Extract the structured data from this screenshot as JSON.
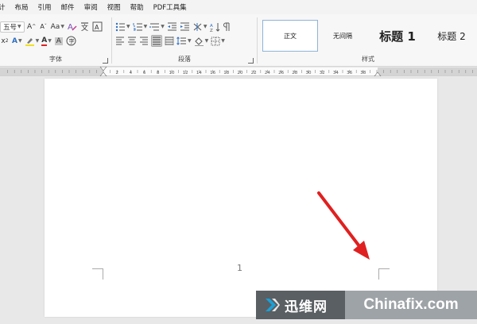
{
  "menu": {
    "items": [
      "计",
      "布局",
      "引用",
      "邮件",
      "审阅",
      "视图",
      "帮助",
      "PDF工具集"
    ]
  },
  "ribbon": {
    "font": {
      "label": "字体",
      "font_size": "五号",
      "grow_label": "A",
      "shrink_label": "A",
      "case_label": "Aa",
      "row2_x_label": "x",
      "text_effects_label": "A",
      "font_color_label": "A",
      "char_shade_label": "A"
    },
    "paragraph": {
      "label": "段落"
    },
    "styles": {
      "label": "样式",
      "items": [
        "正文",
        "无间隔",
        "标题 1",
        "标题 2"
      ]
    }
  },
  "ruler": {
    "ticks": [
      "2",
      "4",
      "6",
      "8",
      "10",
      "12",
      "14",
      "16",
      "18",
      "20",
      "22",
      "24",
      "26",
      "28",
      "30",
      "32",
      "34",
      "36",
      "38"
    ]
  },
  "document": {
    "page_number": "1"
  },
  "annotation": {
    "arrow_color": "#e02020"
  },
  "watermark": {
    "cn_text": "迅维网",
    "en_text": "Chinafix.com"
  }
}
